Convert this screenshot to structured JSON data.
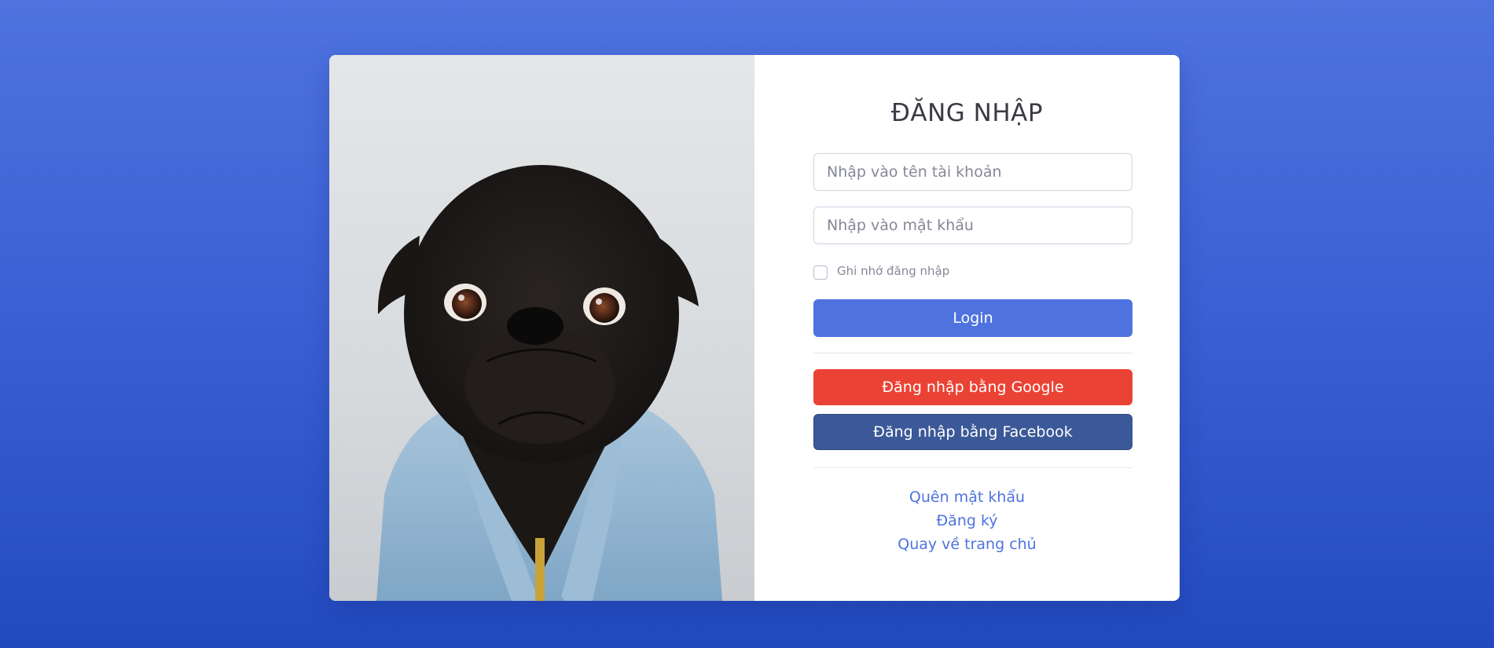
{
  "login_card": {
    "image": {
      "description_icon": "pug-in-denim-jacket-photo"
    },
    "form": {
      "title": "ĐĂNG NHẬP",
      "username_placeholder": "Nhập vào tên tài khoản",
      "password_placeholder": "Nhập vào mật khẩu",
      "remember_label": "Ghi nhớ đăng nhập",
      "remember_checked": false,
      "login_button": "Login",
      "google_button": "Đăng nhập bằng Google",
      "facebook_button": "Đăng nhập bằng Facebook",
      "links": {
        "forgot_password": "Quên mật khẩu",
        "register": "Đăng ký",
        "back_home": "Quay về trang chủ"
      }
    }
  },
  "colors": {
    "background_top": "#4e73df",
    "background_bottom": "#224abe",
    "primary": "#4e73df",
    "google": "#ea4335",
    "facebook": "#3b5998",
    "link": "#4e73df"
  }
}
